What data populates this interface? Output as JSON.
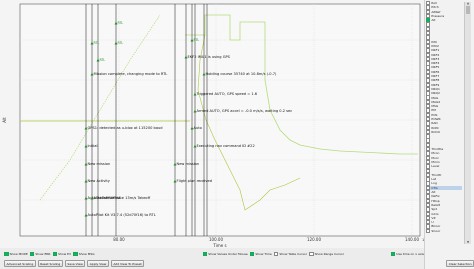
{
  "plot": {
    "y_axis_label": "Alt",
    "x_axis_label": "Time s",
    "x_ticks": [
      "80.00",
      "100.00",
      "120.00",
      "140.00"
    ],
    "x_axis_end_label": "1",
    "events": [
      "EKF2 IMU1 is using GPS",
      "Mission complete, changing mode to RTL",
      "Holding course 35740 at 10.8m/s (-0.7)",
      "Triggered AUTO, GPS speed = 1.6",
      "Armed AUTO, GPS accel = -0.0 m/s/s, waiting 0.2 sec",
      "GPS1: detected as u-blox at 115200 baud",
      "Auto",
      "Executing nav command ID #22",
      "Initial",
      "New mission",
      "New Activity",
      "Flight plan received",
      "New mission",
      "AutoTakeoffStateA",
      "AutoTakeoffState 13m/s Takeoff",
      "AutoPilot Kit V3.7.4 (52d70f16) to RTL"
    ],
    "waypoint_markers": [
      "RTL",
      "RTL",
      "RTL",
      "RTL",
      "RTL"
    ],
    "colors": {
      "green": "#2d8a2d",
      "olive": "#a8c840",
      "lightgreen": "#b4dc7a",
      "grid": "#dcdcdc",
      "axis": "#555555"
    }
  },
  "params": [
    {
      "label": "Roll",
      "checked": false
    },
    {
      "label": "Pitch",
      "checked": false
    },
    {
      "label": "AltRef",
      "checked": false
    },
    {
      "label": "Pressure",
      "checked": false
    },
    {
      "label": "Alt",
      "checked": true
    },
    {
      "label": "",
      "checked": false
    },
    {
      "label": "",
      "checked": false
    },
    {
      "label": "",
      "checked": false
    },
    {
      "label": "",
      "checked": false
    },
    {
      "label": "IMU",
      "checked": false
    },
    {
      "label": "IMU2",
      "checked": false
    },
    {
      "label": "NKF1",
      "checked": false
    },
    {
      "label": "NKF2",
      "checked": false
    },
    {
      "label": "NKF3",
      "checked": false
    },
    {
      "label": "NKF4",
      "checked": false
    },
    {
      "label": "NKF5",
      "checked": false
    },
    {
      "label": "NKF6",
      "checked": false
    },
    {
      "label": "NKF7",
      "checked": false
    },
    {
      "label": "NKF8",
      "checked": false
    },
    {
      "label": "NKF9",
      "checked": false
    },
    {
      "label": "NKQ1",
      "checked": false
    },
    {
      "label": "NKQ2",
      "checked": false
    },
    {
      "label": "MAG",
      "checked": false
    },
    {
      "label": "MAG2",
      "checked": false
    },
    {
      "label": "MSG",
      "checked": false
    },
    {
      "label": "PM",
      "checked": false
    },
    {
      "label": "POS",
      "checked": false
    },
    {
      "label": "POWR",
      "checked": false
    },
    {
      "label": "RAD",
      "checked": false
    },
    {
      "label": "RCIN",
      "checked": false
    },
    {
      "label": "RCOU",
      "checked": false
    },
    {
      "label": "",
      "checked": false
    },
    {
      "label": "",
      "checked": false
    },
    {
      "label": "",
      "checked": false
    },
    {
      "label": "Throttle",
      "checked": false
    },
    {
      "label": "Mcon",
      "checked": false
    },
    {
      "label": "Mvol",
      "checked": false
    },
    {
      "label": "Mmin",
      "checked": false
    },
    {
      "label": "Level",
      "checked": false
    },
    {
      "label": "",
      "checked": false
    },
    {
      "label": "Throttl",
      "checked": false
    },
    {
      "label": "Lat",
      "checked": false
    },
    {
      "label": "Lng",
      "checked": false
    },
    {
      "label": "CTG",
      "checked": false,
      "selected": true
    },
    {
      "label": "Alt",
      "checked": false
    },
    {
      "label": "NeFix",
      "checked": false
    },
    {
      "label": "HDop",
      "checked": false
    },
    {
      "label": "RelAlt",
      "checked": false
    },
    {
      "label": "Spd",
      "checked": false
    },
    {
      "label": "GCrs",
      "checked": false
    },
    {
      "label": "VZ",
      "checked": false
    },
    {
      "label": "U",
      "checked": false
    },
    {
      "label": "BCoor",
      "checked": false
    },
    {
      "label": "SCoor",
      "checked": false
    }
  ],
  "toolbar_row1": {
    "show_mode": "Show MODE",
    "show_err": "Show ERR",
    "show_ev": "Show EV",
    "show_msg": "Show MSG",
    "show_values_under_mouse": "Show Values Under Mouse",
    "show_time": "Show Time",
    "show_table_cursor": "Show Table Cursor",
    "show_range_cursor": "Show Range Cursor",
    "use_time_on_x_axis": "Use time on x axis"
  },
  "toolbar_row2": {
    "advanced": "Advanced Scaling",
    "reset_scaling": "Reset Scaling",
    "save_view": "Save View",
    "apply_view": "Apply View",
    "add_view": "Add View To Preset",
    "clear_selection": "Clear Selection"
  }
}
